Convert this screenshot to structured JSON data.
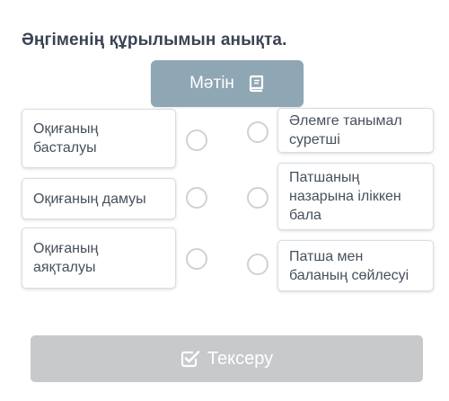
{
  "title": "Әңгіменің құрылымын анықта.",
  "text_button": {
    "label": "Мәтін",
    "icon": "book-icon"
  },
  "left_items": [
    {
      "label": "Оқиғаның басталуы"
    },
    {
      "label": "Оқиғаның дамуы"
    },
    {
      "label": "Оқиғаның аяқталуы"
    }
  ],
  "right_items": [
    {
      "label": "Әлемге танымал суретші"
    },
    {
      "label": "Патшаның назарына іліккен бала"
    },
    {
      "label": "Патша мен баланың сөйлесуі"
    }
  ],
  "check_button": {
    "label": "Тексеру",
    "icon": "check-square-icon"
  },
  "colors": {
    "text_button_bg": "#8fa6b4",
    "check_button_bg": "#c8c9cb",
    "title": "#3b4453"
  }
}
